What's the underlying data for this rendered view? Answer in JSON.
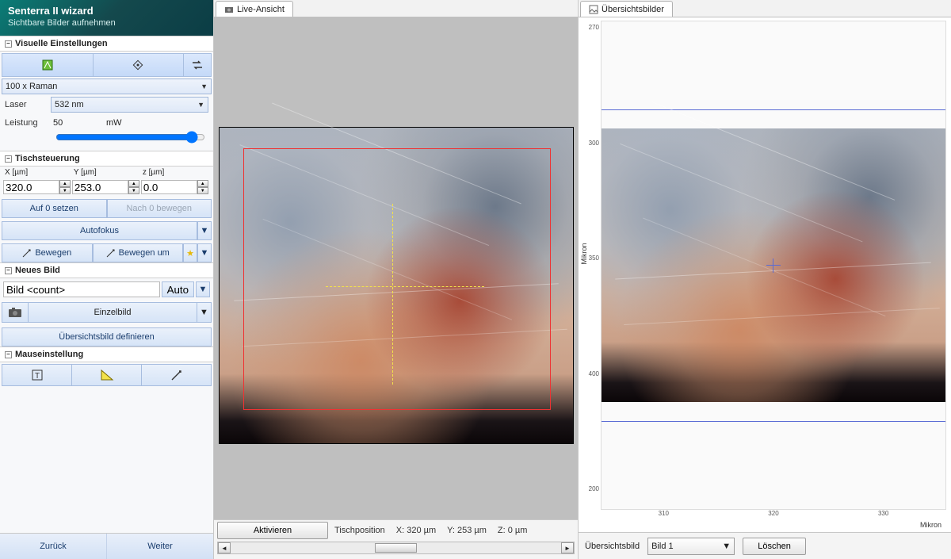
{
  "wizard": {
    "title": "Senterra II wizard",
    "subtitle": "Sichtbare Bilder aufnehmen"
  },
  "sections": {
    "visual": "Visuelle Einstellungen",
    "stage": "Tischsteuerung",
    "newimg": "Neues Bild",
    "mouse": "Mauseinstellung"
  },
  "visual": {
    "objective": "100 x Raman",
    "laser_label": "Laser",
    "laser_value": "532 nm",
    "power_label": "Leistung",
    "power_value": "50",
    "power_unit": "mW"
  },
  "stage": {
    "x_label": "X [µm]",
    "y_label": "Y [µm]",
    "z_label": "z [µm]",
    "x": "320.0",
    "y": "253.0",
    "z": "0.0",
    "set_zero": "Auf 0 setzen",
    "move_zero": "Nach 0 bewegen",
    "autofocus": "Autofokus",
    "move": "Bewegen",
    "move_by": "Bewegen um"
  },
  "newimg": {
    "name_value": "Bild <count>",
    "auto": "Auto",
    "single": "Einzelbild",
    "define_overview": "Übersichtsbild definieren"
  },
  "nav": {
    "back": "Zurück",
    "next": "Weiter"
  },
  "center": {
    "tab": "Live-Ansicht",
    "activate": "Aktivieren",
    "pos_label": "Tischposition",
    "x": "X: 320 µm",
    "y": "Y: 253 µm",
    "z": "Z: 0 µm"
  },
  "right": {
    "tab": "Übersichtsbilder",
    "y_axis": "Mikron",
    "x_axis": "Mikron",
    "y_ticks": [
      "270",
      "300",
      "350",
      "400",
      "200"
    ],
    "x_ticks": [
      "310",
      "320",
      "330"
    ],
    "footer_label": "Übersichtsbild",
    "selected": "Bild 1",
    "delete": "Löschen"
  }
}
